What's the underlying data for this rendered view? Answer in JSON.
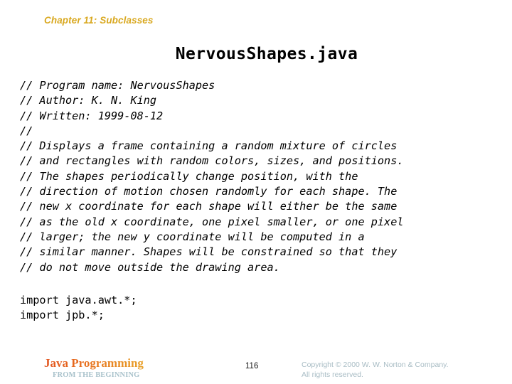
{
  "header": {
    "chapter": "Chapter 11: Subclasses",
    "chapter_color": "#d9a81f"
  },
  "title": "NervousShapes.java",
  "code": {
    "comment_lines": [
      "// Program name: NervousShapes",
      "// Author: K. N. King",
      "// Written: 1999-08-12",
      "//",
      "// Displays a frame containing a random mixture of circles",
      "// and rectangles with random colors, sizes, and positions.",
      "// The shapes periodically change position, with the",
      "// direction of motion chosen randomly for each shape. The",
      "// new x coordinate for each shape will either be the same",
      "// as the old x coordinate, one pixel smaller, or one pixel",
      "// larger; the new y coordinate will be computed in a",
      "// similar manner. Shapes will be constrained so that they",
      "// do not move outside the drawing area."
    ],
    "import_lines": [
      "import java.awt.*;",
      "import jpb.*;"
    ]
  },
  "footer": {
    "brand_title": "Java Programming",
    "brand_subtitle": "FROM THE BEGINNING",
    "page_number": "116",
    "copyright_line1": "Copyright © 2000 W. W. Norton & Company.",
    "copyright_line2": "All rights reserved.",
    "copyright_color": "#a8bcc4",
    "brand_gradient_start": "#e2541f",
    "brand_gradient_end": "#e5bb45",
    "brand_subtitle_color": "#a9c2cb"
  }
}
